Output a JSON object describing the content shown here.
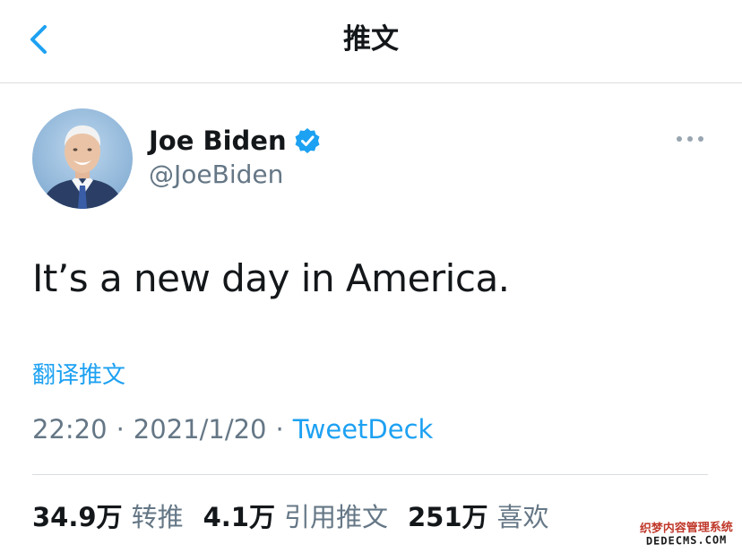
{
  "header": {
    "title": "推文",
    "back_icon": "chevron-left-icon"
  },
  "tweet": {
    "author": {
      "display_name": "Joe Biden",
      "handle": "@JoeBiden",
      "verified_icon": "verified-badge-icon"
    },
    "text": "It’s a new day in America.",
    "translate_label": "翻译推文",
    "time": "22:20",
    "date": "2021/1/20",
    "separator": "·",
    "source": "TweetDeck",
    "stats": [
      {
        "count": "34.9万",
        "label": "转推"
      },
      {
        "count": "4.1万",
        "label": "引用推文"
      },
      {
        "count": "251万",
        "label": "喜欢"
      }
    ]
  },
  "watermark": {
    "line1": "织梦内容管理系统",
    "line2": "DEDECMS.COM"
  },
  "colors": {
    "accent": "#1da1f2",
    "text": "#14171a",
    "muted": "#657786",
    "divider": "#d9dde0"
  }
}
